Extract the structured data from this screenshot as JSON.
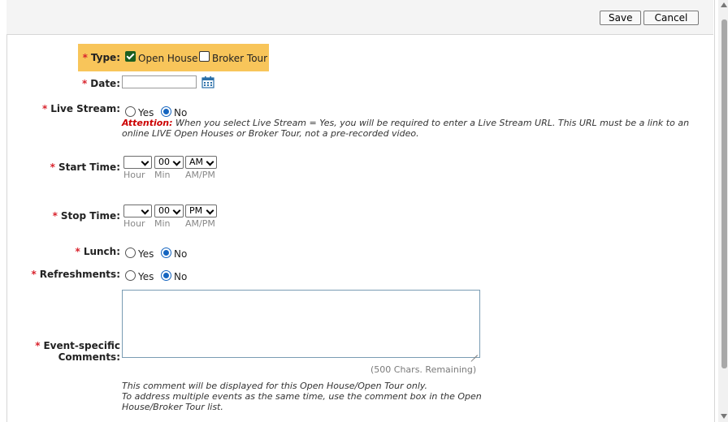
{
  "toolbar": {
    "save_label": "Save",
    "cancel_label": "Cancel"
  },
  "type": {
    "label": "Type:",
    "options": [
      {
        "label": "Open House",
        "checked": true
      },
      {
        "label": "Broker Tour",
        "checked": false
      }
    ]
  },
  "date": {
    "label": "Date:",
    "value": "",
    "icon": "calendar-icon"
  },
  "live_stream": {
    "label": "Live Stream:",
    "yes": "Yes",
    "no": "No",
    "selected": "No",
    "attention_label": "Attention:",
    "attention_text": "When you select Live Stream = Yes, you will be required to enter a Live Stream URL. This URL must be a link to an online LIVE Open Houses or Broker Tour, not a pre-recorded video."
  },
  "start_time": {
    "label": "Start Time:",
    "hour": "",
    "min": "00",
    "ampm": "AM",
    "hour_label": "Hour",
    "min_label": "Min",
    "ampm_label": "AM/PM"
  },
  "stop_time": {
    "label": "Stop Time:",
    "hour": "",
    "min": "00",
    "ampm": "PM",
    "hour_label": "Hour",
    "min_label": "Min",
    "ampm_label": "AM/PM"
  },
  "lunch": {
    "label": "Lunch:",
    "yes": "Yes",
    "no": "No",
    "selected": "No"
  },
  "refreshments": {
    "label": "Refreshments:",
    "yes": "Yes",
    "no": "No",
    "selected": "No"
  },
  "comments": {
    "label_line1": "Event-specific",
    "label_line2": "Comments:",
    "value": "",
    "remaining": "(500 Chars. Remaining)",
    "note_line1": "This comment will be displayed for this Open House/Open Tour only.",
    "note_line2": "To address multiple events as the same time, use the comment box in the Open House/Broker Tour list."
  },
  "required_marker": "*",
  "colors": {
    "highlight": "#f8c55a",
    "required": "#d9232d",
    "attention": "#cc0000",
    "radio_selected": "#1565c0",
    "checkbox_checked": "#1b5e20"
  }
}
